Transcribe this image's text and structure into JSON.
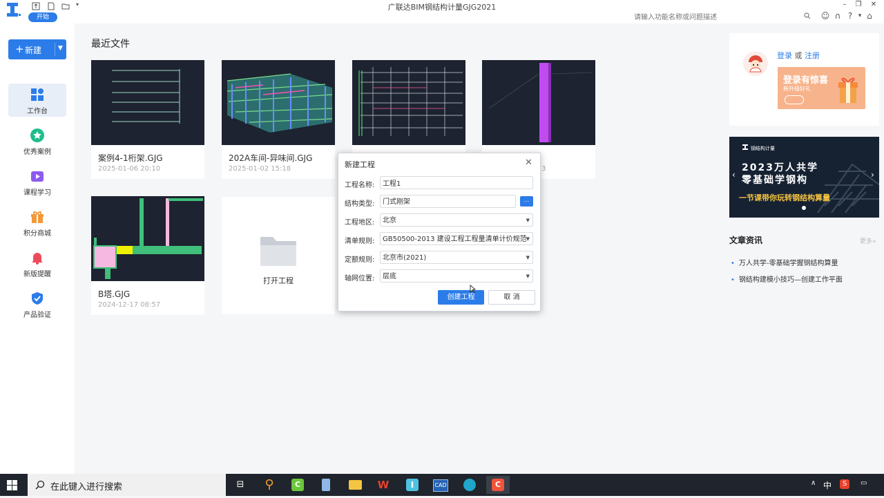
{
  "app": {
    "title": "广联达BIM钢结构计量GJG2021",
    "start_badge": "开始"
  },
  "header": {
    "search_placeholder": "请输入功能名称或问题描述"
  },
  "sidebar": {
    "new_button": "新建",
    "items": [
      {
        "label": "工作台",
        "icon": "workbench-icon"
      },
      {
        "label": "优秀案例",
        "icon": "star-icon"
      },
      {
        "label": "课程学习",
        "icon": "video-icon"
      },
      {
        "label": "积分商城",
        "icon": "gift-icon"
      },
      {
        "label": "新版提醒",
        "icon": "bell-icon"
      },
      {
        "label": "产品验证",
        "icon": "shield-icon"
      }
    ]
  },
  "main": {
    "section_title": "最近文件",
    "files": [
      {
        "name": "案例4-1桁架.GJG",
        "date": "2025-01-06 20:10"
      },
      {
        "name": "202A车间-异味间.GJG",
        "date": "2025-01-02 15:18"
      },
      {
        "name": "",
        "date": ""
      },
      {
        "name": "",
        "date": "3"
      },
      {
        "name": "B塔.GJG",
        "date": "2024-12-17 08:57"
      }
    ],
    "open_project": "打开工程"
  },
  "right": {
    "login": "登录",
    "or": "或",
    "register": "注册",
    "promo_title": "登录有惊喜",
    "promo_sub": "新升级好礼",
    "banner_brand": "钢结构计量",
    "banner_line1": "2023万人共学",
    "banner_line2": "零基础学钢构",
    "banner_line3": "一节课带你玩转钢结构算量",
    "news_title": "文章资讯",
    "news_more": "更多»",
    "news": [
      "万人共学-零基础学握钢结构算量",
      "钢结构建模小技巧—创建工作平面"
    ]
  },
  "dialog": {
    "title": "新建工程",
    "fields": [
      {
        "label": "工程名称:",
        "value": "工程1"
      },
      {
        "label": "结构类型:",
        "value": "门式刚架"
      },
      {
        "label": "工程地区:",
        "value": "北京"
      },
      {
        "label": "清单规则:",
        "value": "GB50500-2013 建设工程工程量清单计价规范"
      },
      {
        "label": "定额规则:",
        "value": "北京市(2021)"
      },
      {
        "label": "轴网位置:",
        "value": "层底"
      }
    ],
    "browse": "...",
    "create": "创建工程",
    "cancel": "取 消"
  },
  "taskbar": {
    "search": "在此键入进行搜索",
    "ime": "中",
    "apps": [
      "task-view-icon",
      "magnifier-app-icon",
      "camtasia-icon",
      "file-icon",
      "folder-icon",
      "wps-icon",
      "glodon-app-icon",
      "cad-app-icon",
      "edge-icon",
      "recorder-app-icon"
    ]
  },
  "colors": {
    "accent": "#2b7ce9",
    "taskbar": "#20242c",
    "thumb_bg": "#1d2330"
  }
}
